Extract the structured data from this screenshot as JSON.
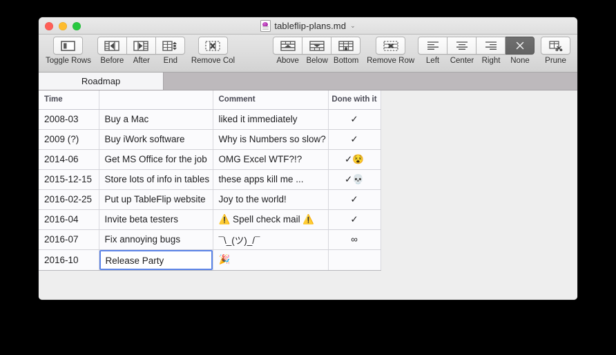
{
  "window": {
    "title": "tableflip-plans.md",
    "title_chevron": "⌄",
    "doc_icon": "markdown-document-icon",
    "traffic_lights": {
      "close": "#ff5f57",
      "minimize": "#febc2e",
      "zoom": "#28c840"
    }
  },
  "toolbar": {
    "groups": [
      {
        "name": "view",
        "buttons": [
          {
            "label": "Toggle Rows",
            "icon": "toggle-rows-icon",
            "selected": false
          }
        ]
      },
      {
        "name": "columns",
        "buttons": [
          {
            "label": "Before",
            "icon": "insert-column-before-icon",
            "selected": false
          },
          {
            "label": "After",
            "icon": "insert-column-after-icon",
            "selected": false
          },
          {
            "label": "End",
            "icon": "insert-column-end-icon",
            "selected": false
          }
        ]
      },
      {
        "name": "remove-column",
        "buttons": [
          {
            "label": "Remove Col",
            "icon": "remove-column-icon",
            "selected": false
          }
        ]
      },
      {
        "name": "rows",
        "buttons": [
          {
            "label": "Above",
            "icon": "insert-row-above-icon",
            "selected": false
          },
          {
            "label": "Below",
            "icon": "insert-row-below-icon",
            "selected": false
          },
          {
            "label": "Bottom",
            "icon": "insert-row-bottom-icon",
            "selected": false
          }
        ]
      },
      {
        "name": "remove-row",
        "buttons": [
          {
            "label": "Remove Row",
            "icon": "remove-row-icon",
            "selected": false
          }
        ]
      },
      {
        "name": "alignment",
        "buttons": [
          {
            "label": "Left",
            "icon": "align-left-icon",
            "selected": false
          },
          {
            "label": "Center",
            "icon": "align-center-icon",
            "selected": false
          },
          {
            "label": "Right",
            "icon": "align-right-icon",
            "selected": false
          },
          {
            "label": "None",
            "icon": "align-none-icon",
            "selected": true
          }
        ]
      },
      {
        "name": "prune",
        "buttons": [
          {
            "label": "Prune",
            "icon": "prune-icon",
            "selected": false
          }
        ]
      }
    ]
  },
  "tabs": [
    {
      "label": "Roadmap",
      "active": true
    }
  ],
  "table": {
    "headers": [
      "Time",
      "",
      "Comment",
      "Done with it"
    ],
    "rows": [
      {
        "time": "2008-03",
        "task": "Buy a Mac",
        "comment": "liked it immediately",
        "done": "✓"
      },
      {
        "time": "2009 (?)",
        "task": "Buy iWork software",
        "comment": "Why is Numbers so slow?",
        "done": "✓"
      },
      {
        "time": "2014-06",
        "task": "Get MS Office for the job",
        "comment": "OMG Excel WTF?!?",
        "done": "✓😵"
      },
      {
        "time": "2015-12-15",
        "task": "Store lots of info in tables",
        "comment": "these apps kill me ...",
        "done": "✓💀"
      },
      {
        "time": "2016-02-25",
        "task": "Put up TableFlip website",
        "comment": "Joy to the world!",
        "done": "✓"
      },
      {
        "time": "2016-04",
        "task": "Invite beta testers",
        "comment": "⚠️ Spell check mail ⚠️",
        "done": "✓"
      },
      {
        "time": "2016-07",
        "task": "Fix annoying bugs",
        "comment": "¯\\_(ツ)_/¯",
        "done": "∞"
      },
      {
        "time": "2016-10",
        "task": "Release Party",
        "comment": "🎉",
        "done": "",
        "editing_cell": "task"
      }
    ]
  },
  "colors": {
    "focus_ring": "#5b84e8",
    "tabbar_bg": "#bdb9bc",
    "active_tab_bg": "#f5f5f7",
    "sheet_bg": "#eeeeee",
    "selected_button_bg": "#636363"
  }
}
